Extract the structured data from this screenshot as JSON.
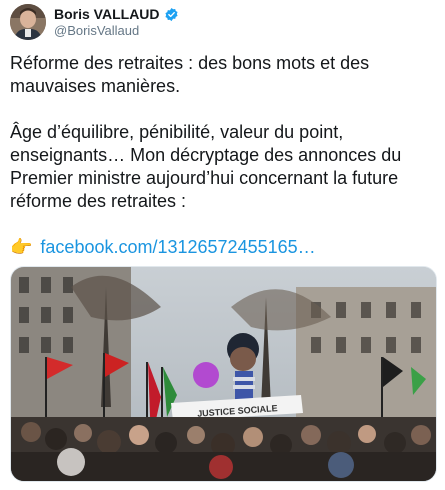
{
  "author": {
    "display_name": "Boris VALLAUD",
    "handle": "@BorisVallaud",
    "verified": true,
    "avatar_icon": "avatar-photo"
  },
  "tweet": {
    "paragraph_1": "Réforme des retraites : des bons mots et des\nmauvaises manières.",
    "paragraph_2": "Âge d’équilibre, pénibilité, valeur du point,\nenseignants… Mon décryptage des annonces du\nPremier ministre aujourd’hui concernant la future\nréforme des retraites :",
    "link_icon": "backhand-index-pointing-right",
    "link_text": "facebook.com/13126572455165…"
  },
  "media": {
    "banner_text": "JUSTICE SOCIALE"
  },
  "colors": {
    "link": "#1b95e0",
    "verified": "#1da1f2",
    "handle": "#657786"
  }
}
